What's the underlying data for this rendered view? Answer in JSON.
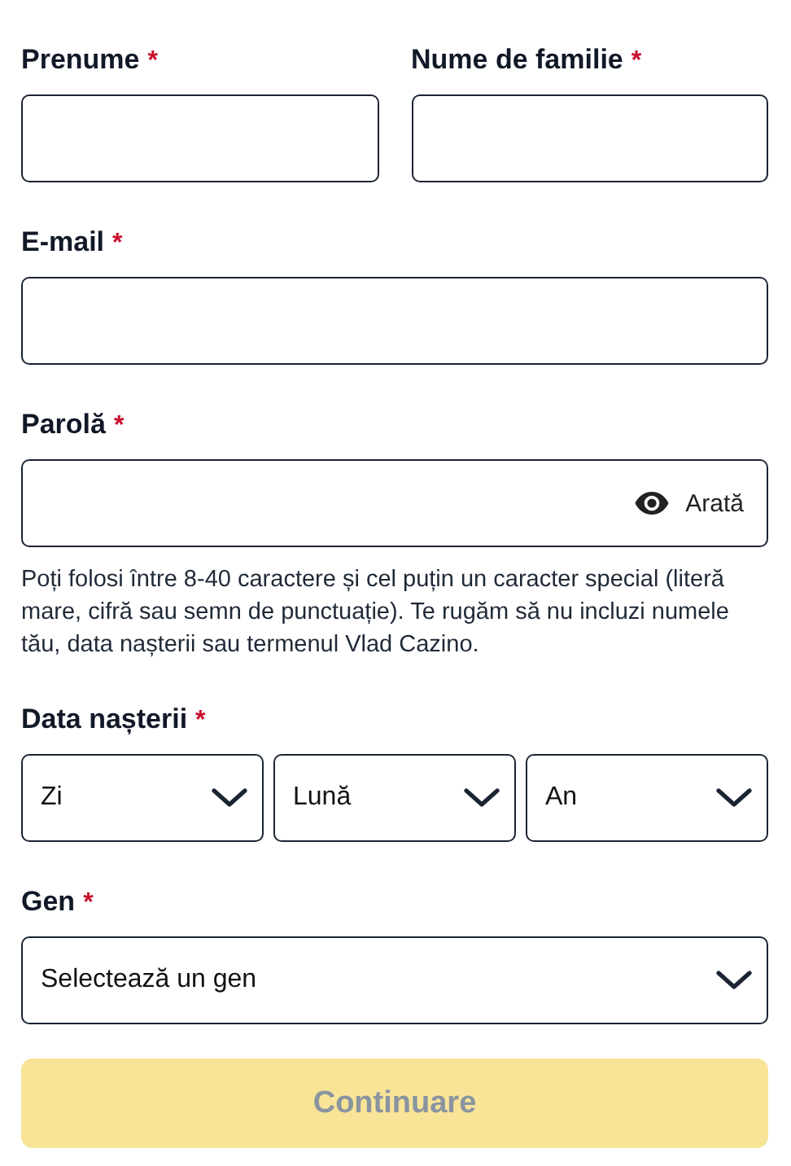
{
  "first_name": {
    "label": "Prenume",
    "required_mark": "*"
  },
  "last_name": {
    "label": "Nume de familie",
    "required_mark": "*"
  },
  "email": {
    "label": "E-mail",
    "required_mark": "*"
  },
  "password": {
    "label": "Parolă",
    "required_mark": "*",
    "toggle": "Arată"
  },
  "password_hint": "Poți folosi între 8-40 caractere și cel puțin un caracter special (literă mare, cifră sau semn de punctuație). Te rugăm să nu incluzi numele tău, data nașterii sau termenul Vlad Cazino.",
  "birth_date": {
    "label": "Data nașterii",
    "required_mark": "*",
    "selects": [
      {
        "placeholder": "Zi"
      },
      {
        "placeholder": "Lună"
      },
      {
        "placeholder": "An"
      }
    ]
  },
  "gender": {
    "label": "Gen",
    "required_mark": "*",
    "placeholder": "Selectează un gen"
  },
  "continue_button": {
    "label": "Continuare",
    "disabled": true
  }
}
